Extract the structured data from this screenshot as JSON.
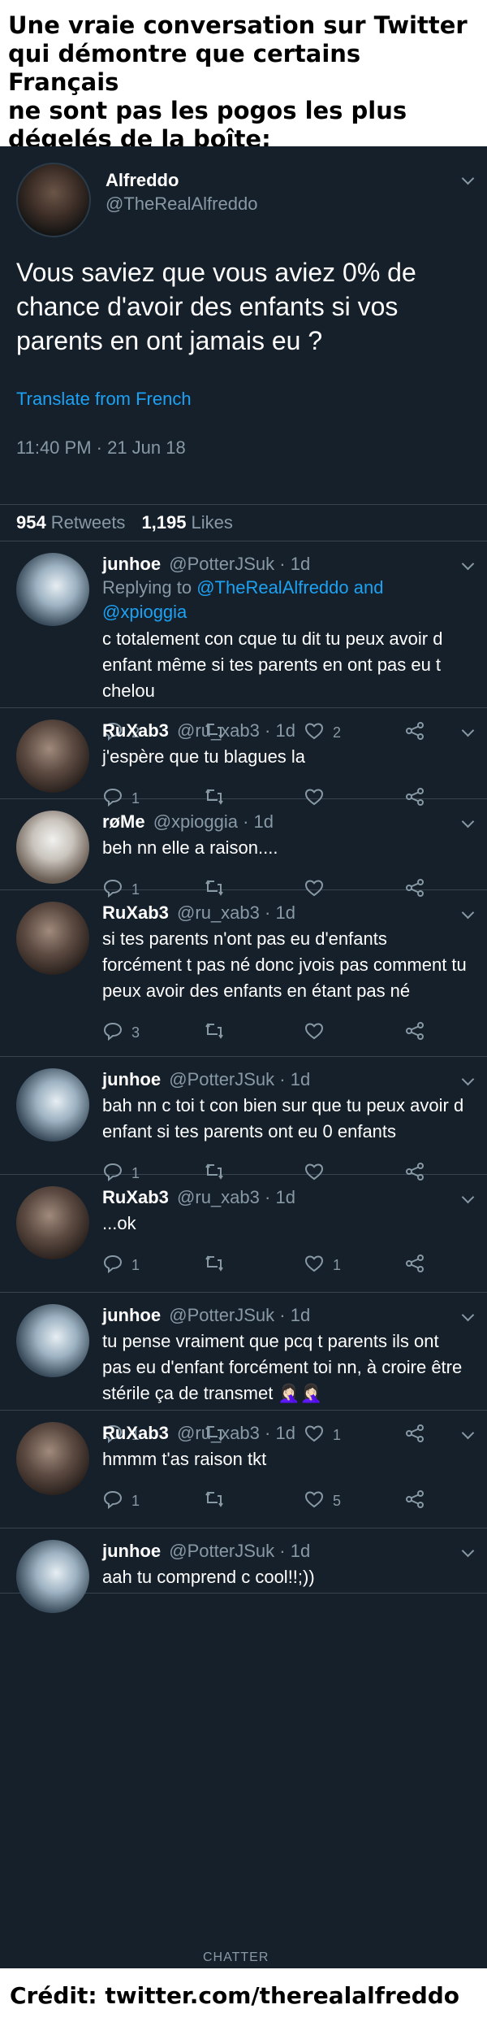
{
  "caption": {
    "line1": "Une vraie conversation sur Twitter",
    "line2": "qui démontre que certains Français",
    "line3": "ne sont pas les pogos les plus",
    "line4": "dégelés de la boîte:"
  },
  "main_tweet": {
    "name": "Alfreddo",
    "handle": "@TheRealAlfreddo",
    "text": "Vous saviez que vous aviez 0% de chance d'avoir des enfants si vos parents en ont jamais eu ?",
    "translate": "Translate from French",
    "datetime": "11:40 PM · 21 Jun 18",
    "retweets_count": "954",
    "retweets_label": "Retweets",
    "likes_count": "1,195",
    "likes_label": "Likes"
  },
  "replies": [
    {
      "name": "junhoe",
      "handle": "@PotterJSuk",
      "age": "· 1d",
      "replying_prefix": "Replying to",
      "replying_to": "@TheRealAlfreddo and @xpioggia",
      "text": "c totalement con cque tu dit tu peux avoir d enfant même si tes parents en ont pas eu t chelou",
      "replies": "2",
      "retweets": "",
      "likes": "2",
      "avatar": "junhoe"
    },
    {
      "name": "RuXab3",
      "handle": "@ru_xab3",
      "age": "· 1d",
      "text": "j'espère que tu blagues la",
      "replies": "1",
      "retweets": "",
      "likes": "",
      "avatar": "ruxab3"
    },
    {
      "name": "røMe",
      "handle": "@xpioggia",
      "age": "· 1d",
      "text": "beh nn elle a raison....",
      "replies": "1",
      "retweets": "",
      "likes": "",
      "avatar": "rome"
    },
    {
      "name": "RuXab3",
      "handle": "@ru_xab3",
      "age": "· 1d",
      "text": "si tes parents n'ont pas eu d'enfants forcément t pas né donc jvois pas comment tu peux avoir des enfants en étant pas né",
      "replies": "3",
      "retweets": "",
      "likes": "",
      "avatar": "ruxab3"
    },
    {
      "name": "junhoe",
      "handle": "@PotterJSuk",
      "age": "· 1d",
      "text": "bah nn c toi t con bien sur que tu peux avoir d enfant si tes parents ont eu 0 enfants",
      "replies": "1",
      "retweets": "",
      "likes": "",
      "avatar": "junhoe"
    },
    {
      "name": "RuXab3",
      "handle": "@ru_xab3",
      "age": "· 1d",
      "text": "...ok",
      "replies": "1",
      "retweets": "",
      "likes": "1",
      "avatar": "ruxab3"
    },
    {
      "name": "junhoe",
      "handle": "@PotterJSuk",
      "age": "· 1d",
      "text": "tu pense vraiment que pcq t parents ils ont pas eu d'enfant forcément toi nn, à croire être stérile ça de transmet 🤦🏻‍♀️🤦🏻‍♀️",
      "replies": "1",
      "retweets": "",
      "likes": "1",
      "avatar": "junhoe"
    },
    {
      "name": "RuXab3",
      "handle": "@ru_xab3",
      "age": "· 1d",
      "text": "hmmm t'as raison tkt",
      "replies": "1",
      "retweets": "",
      "likes": "5",
      "avatar": "ruxab3"
    },
    {
      "name": "junhoe",
      "handle": "@PotterJSuk",
      "age": "· 1d",
      "text": "aah tu comprend c cool!!;))",
      "avatar": "junhoe"
    }
  ],
  "watermark": "CHATTER",
  "credit": "Crédit: twitter.com/therealalfreddo",
  "colors": {
    "background": "#15202b",
    "accent": "#1da1f2",
    "muted": "#8899a6",
    "divider": "#38444d"
  },
  "icons": [
    "reply-icon",
    "retweet-icon",
    "like-icon",
    "share-icon",
    "chevron-down-icon"
  ]
}
